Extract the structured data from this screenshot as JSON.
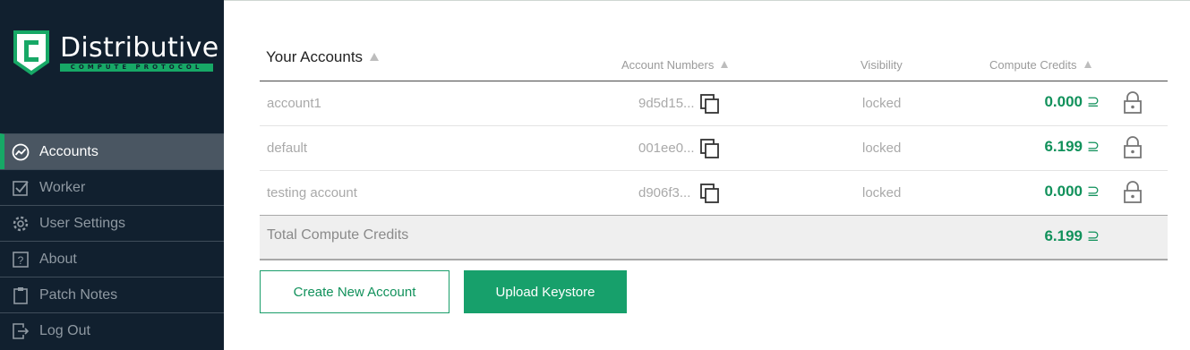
{
  "brand": {
    "name": "Distributive",
    "tagline": "COMPUTE PROTOCOL",
    "accent": "#17a866",
    "sidebar_bg": "#11202f"
  },
  "sidebar": {
    "items": [
      {
        "label": "Accounts",
        "icon": "chart-icon",
        "active": true
      },
      {
        "label": "Worker",
        "icon": "checkbox-icon",
        "active": false
      },
      {
        "label": "User Settings",
        "icon": "gear-icon",
        "active": false
      },
      {
        "label": "About",
        "icon": "question-icon",
        "active": false
      },
      {
        "label": "Patch Notes",
        "icon": "clipboard-icon",
        "active": false
      },
      {
        "label": "Log Out",
        "icon": "logout-icon",
        "active": false
      }
    ]
  },
  "table": {
    "headers": {
      "accounts": "Your Accounts",
      "numbers": "Account Numbers",
      "visibility": "Visibility",
      "credits": "Compute Credits"
    },
    "rows": [
      {
        "name": "account1",
        "number": "9d5d15...",
        "visibility": "locked",
        "credits": "0.000",
        "currency": "⊇"
      },
      {
        "name": "default",
        "number": "001ee0...",
        "visibility": "locked",
        "credits": "6.199",
        "currency": "⊇"
      },
      {
        "name": "testing account",
        "number": "d906f3...",
        "visibility": "locked",
        "credits": "0.000",
        "currency": "⊇"
      }
    ],
    "total": {
      "label": "Total Compute Credits",
      "credits": "6.199",
      "currency": "⊇"
    }
  },
  "actions": {
    "create_label": "Create New Account",
    "upload_label": "Upload Keystore"
  }
}
